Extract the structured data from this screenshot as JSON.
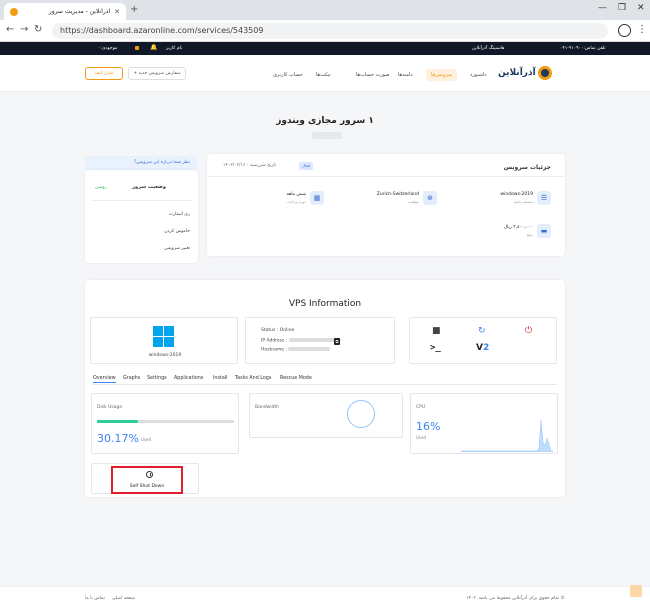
{
  "browser": {
    "tab_title": "آذرآنلاین - مدیریت سرور",
    "url": "https://dashboard.azaronline.com/services/543509"
  },
  "topstrip": {
    "phone": "تلفن تماس:۹۱۰۹۰۰-۰۴۱",
    "hosting": "هاستینگ آذرآنلاین",
    "username": "نام کاربر",
    "wallet": "موجودی:۰"
  },
  "nav": {
    "logo": "آذرآنلاین",
    "items": [
      "داشبورد",
      "سرویس‌ها",
      "دامنه‌ها",
      "صورت حساب‌ها",
      "تیکت‌ها",
      "حساب کاربری"
    ],
    "active_index": 1,
    "add_service": "سفارش سرویس جدید +",
    "wallet_button": "شارژ کیف"
  },
  "page": {
    "title": "۱ سرور مجازی ویندوز"
  },
  "service_details": {
    "title": "جزئیات سرویس",
    "status_badge": "فعال",
    "due_date": "تاریخ سررسید : ۱۴۰۲/۰۳/۱۶",
    "items": [
      {
        "icon": "os-icon",
        "value": "windows-2019",
        "label": "سیستم عامل"
      },
      {
        "icon": "globe-icon",
        "value": "Zurich-Switzerland",
        "label": "موقعیت"
      },
      {
        "icon": "calendar-icon",
        "value": "شش ماهه",
        "label": "دوره پرداخت"
      },
      {
        "icon": "money-icon",
        "value": "۳,۸۰۰,۰۰۰ ریال",
        "label": "مبلغ"
      }
    ]
  },
  "server_status": {
    "help": "نظر شما درباره این سرویس؟",
    "title": "وضعیت سرور",
    "state": "روشن",
    "actions": [
      "ری استارت",
      "خاموش کردن",
      "تغییر سرویس"
    ]
  },
  "vps": {
    "title": "VPS Information",
    "os": "windows-2019",
    "status_label": "Status :",
    "status_value": "Online",
    "ip_label": "IP Address :",
    "hostname_label": "Hostname :",
    "tabs": [
      "Overview",
      "Graphs",
      "Settings",
      "Applications",
      "Install",
      "Tasks And Logs",
      "Rescue Mode"
    ],
    "active_tab": 0,
    "disk": {
      "label": "Disk Usage",
      "percent_text": "30.17%",
      "percent": 30.17,
      "used": "Used"
    },
    "bandwidth": {
      "label": "Bandwidth"
    },
    "cpu": {
      "label": "CPU",
      "percent_text": "16%",
      "used": "Used"
    },
    "shutdown": {
      "label": "Self Shut Down"
    },
    "colors": {
      "accent": "#3b82f6",
      "disk_fill": "#2ecc9a",
      "highlight": "#e11d2e"
    }
  },
  "footer": {
    "copyright": "© تمام حقوق برای آذرآنلاین محفوظ می باشد. ۱۴۰۲",
    "home": "صفحه اصلی",
    "contact": "تماس با ما"
  }
}
